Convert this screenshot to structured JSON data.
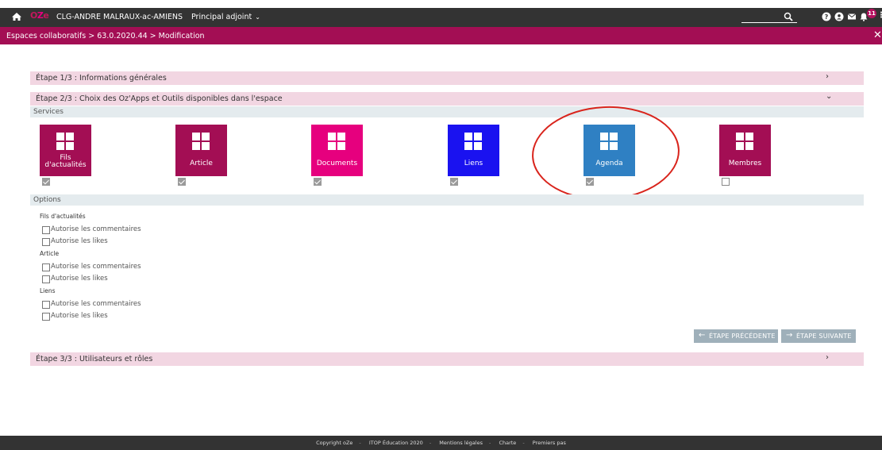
{
  "topbar": {
    "logo": "OZE",
    "school": "CLG-ANDRE MALRAUX-ac-AMIENS",
    "role": "Principal adjoint",
    "notification_count": "11"
  },
  "breadcrumb": "Espaces collaboratifs > 63.0.2020.44 > Modification",
  "steps": {
    "step1": "Étape 1/3 : Informations générales",
    "step2": "Étape 2/3 : Choix des Oz'Apps et Outils disponibles dans l'espace",
    "step3": "Étape 3/3 : Utilisateurs et rôles"
  },
  "services_label": "Services",
  "options_label": "Options",
  "services": [
    {
      "name_line1": "Fils",
      "name_line2": "d'actualités",
      "color": "#a30e54",
      "checked": true
    },
    {
      "name": "Article",
      "color": "#a30e54",
      "checked": true
    },
    {
      "name": "Documents",
      "color": "#e6007e",
      "checked": true
    },
    {
      "name": "Liens",
      "color": "#1a12f0",
      "checked": true
    },
    {
      "name": "Agenda",
      "color": "#2f80c3",
      "checked": true
    },
    {
      "name": "Membres",
      "color": "#a30e54",
      "checked": false
    }
  ],
  "options": {
    "groups": [
      {
        "title": "Fils d'actualités",
        "items": [
          "Autorise les commentaires",
          "Autorise les likes"
        ]
      },
      {
        "title": "Article",
        "items": [
          "Autorise les commentaires",
          "Autorise les likes"
        ]
      },
      {
        "title": "Liens",
        "items": [
          "Autorise les commentaires",
          "Autorise les likes"
        ]
      }
    ]
  },
  "buttons": {
    "prev": "ÉTAPE PRÉCÉDENTE",
    "next": "ÉTAPE SUIVANTE"
  },
  "footer": {
    "copyright": "Copyright oZe",
    "itop": "ITOP Éducation 2020",
    "legal": "Mentions légales",
    "charter": "Charte",
    "first_steps": "Premiers pas"
  },
  "colors": {
    "topbar": "#333333",
    "brand": "#a30e54",
    "step_bg": "#f2d6e2",
    "highlight": "#d9241c"
  }
}
